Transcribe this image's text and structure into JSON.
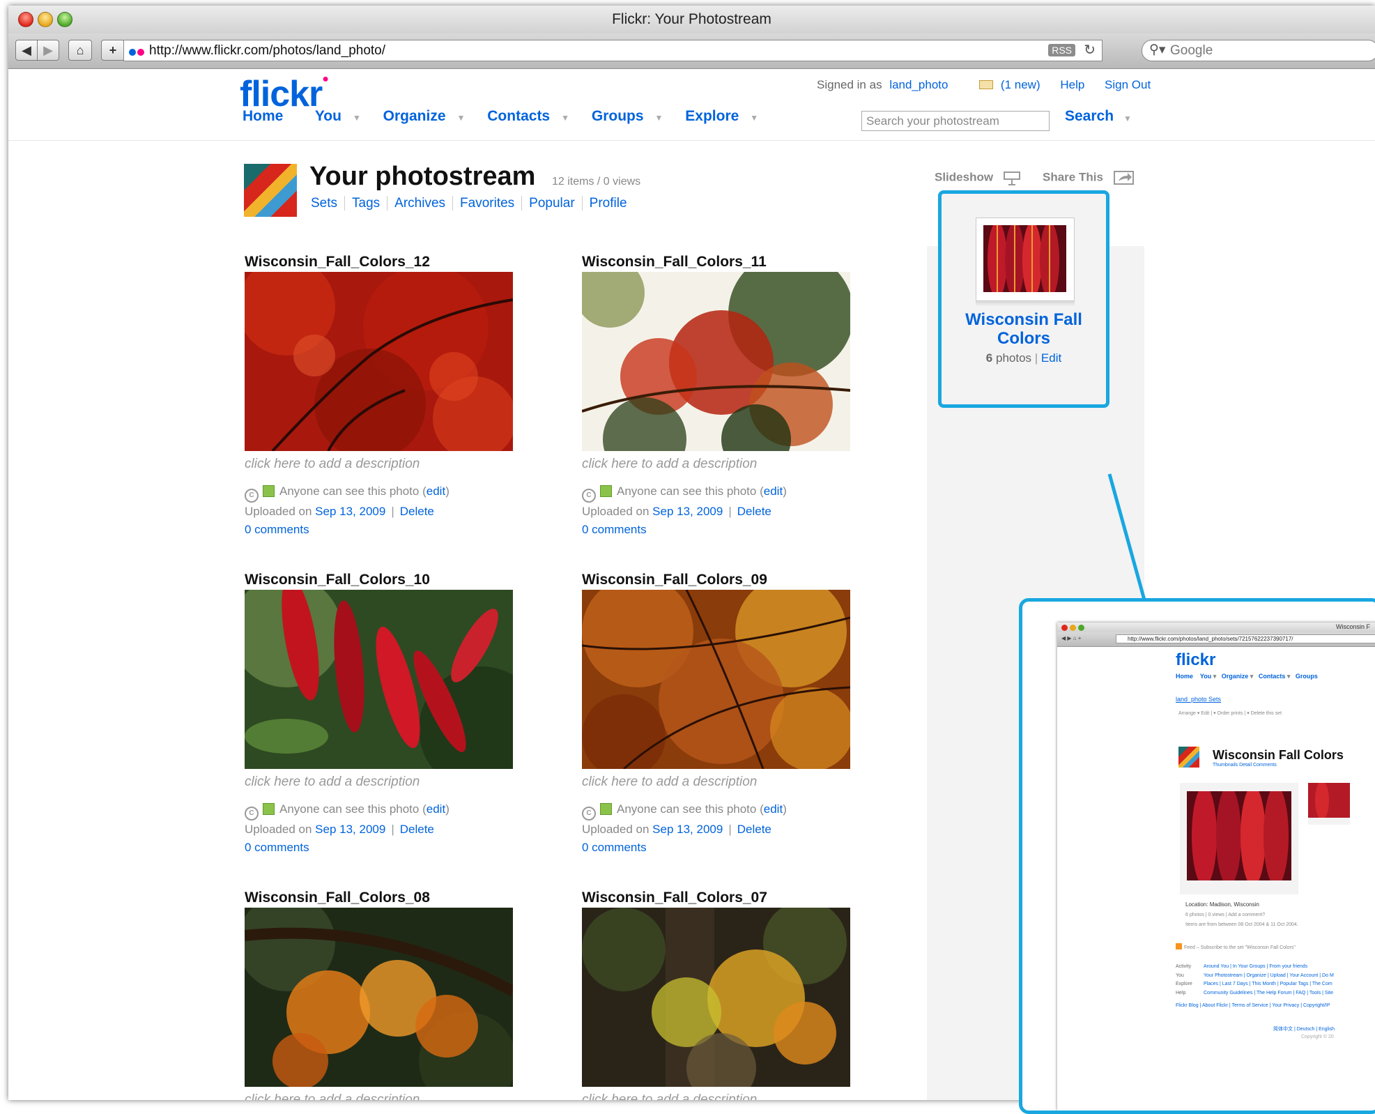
{
  "browser": {
    "window_title": "Flickr: Your Photostream",
    "url": "http://www.flickr.com/photos/land_photo/",
    "rss_label": "RSS",
    "search_placeholder": "Google"
  },
  "header": {
    "logo": "flickr",
    "signed_in_prefix": "Signed in as",
    "username": "land_photo",
    "mail": "(1 new)",
    "help": "Help",
    "sign_out": "Sign Out",
    "nav": [
      "Home",
      "You",
      "Organize",
      "Contacts",
      "Groups",
      "Explore"
    ],
    "search_placeholder": "Search your photostream",
    "search_button": "Search"
  },
  "photostream": {
    "title": "Your photostream",
    "count": "12 items / 0 views",
    "tabs": [
      "Sets",
      "Tags",
      "Archives",
      "Favorites",
      "Popular",
      "Profile"
    ],
    "slideshow": "Slideshow",
    "share": "Share This"
  },
  "photos": [
    {
      "title": "Wisconsin_Fall_Colors_12",
      "desc": "click here to add a description",
      "privacy": "Anyone can see this photo",
      "edit": "edit",
      "uploaded": "Uploaded on",
      "date": "Sep 13, 2009",
      "delete": "Delete",
      "comments": "0 comments"
    },
    {
      "title": "Wisconsin_Fall_Colors_11",
      "desc": "click here to add a description",
      "privacy": "Anyone can see this photo",
      "edit": "edit",
      "uploaded": "Uploaded on",
      "date": "Sep 13, 2009",
      "delete": "Delete",
      "comments": "0 comments"
    },
    {
      "title": "Wisconsin_Fall_Colors_10",
      "desc": "click here to add a description",
      "privacy": "Anyone can see this photo",
      "edit": "edit",
      "uploaded": "Uploaded on",
      "date": "Sep 13, 2009",
      "delete": "Delete",
      "comments": "0 comments"
    },
    {
      "title": "Wisconsin_Fall_Colors_09",
      "desc": "click here to add a description",
      "privacy": "Anyone can see this photo",
      "edit": "edit",
      "uploaded": "Uploaded on",
      "date": "Sep 13, 2009",
      "delete": "Delete",
      "comments": "0 comments"
    },
    {
      "title": "Wisconsin_Fall_Colors_08",
      "desc": "click here to add a description"
    },
    {
      "title": "Wisconsin_Fall_Colors_07",
      "desc": "click here to add a description"
    }
  ],
  "set": {
    "title": "Wisconsin Fall Colors",
    "count": "6",
    "photos_label": "photos",
    "edit": "Edit"
  },
  "inset": {
    "window_title": "Wisconsin F",
    "url": "http://www.flickr.com/photos/land_photo/sets/72157622237390717/",
    "logo": "flickr",
    "nav": [
      "Home",
      "You",
      "Organize",
      "Contacts",
      "Groups"
    ],
    "breadcrumb": "land_photo  Sets",
    "actions": "Arrange  ▾    Edit  |  ▾     Order prints  |  ▾      Delete this set",
    "title": "Wisconsin Fall Colors",
    "views": "Thumbnails   Detail   Comments",
    "location": "Location: Madison, Wisconsin",
    "stats": "6 photos | 0 views | Add a comment?",
    "range": "Items are from between 08 Oct 2004 & 11 Oct 2004.",
    "feed": "Feed – Subscribe to the set \"Wisconsin Fall Colors\"",
    "footer_labels": [
      "Activity",
      "You",
      "Explore",
      "Help"
    ],
    "footer_links": [
      "Around You  |  In Your Groups  |  From your friends",
      "Your Photostream  |  Organize  |  Upload  |  Your Account  |  Do M",
      "Places  |  Last 7 Days  |  This Month  |  Popular Tags  |  The Com",
      "Community Guidelines  |  The Help Forum  |  FAQ  |  Tools  |  Site"
    ],
    "footer_bottom": "Flickr Blog | About Flickr | Terms of Service | Your Privacy | Copyright/IP",
    "lang": "简体中文 | Deutsch | English",
    "copyright": "Copyright © 20"
  },
  "colors": {
    "flickr_blue": "#0063dc",
    "flickr_pink": "#ff0084",
    "highlight": "#19a7e0",
    "sidebar_bg": "#f3f3f3"
  }
}
